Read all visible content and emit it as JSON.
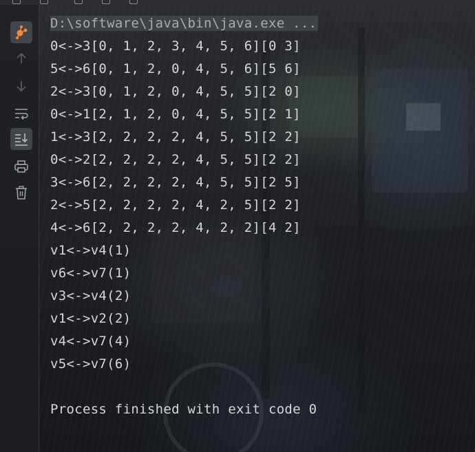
{
  "console": {
    "command": "D:\\software\\java\\bin\\java.exe ...",
    "lines": [
      "0<->3[0, 1, 2, 3, 4, 5, 6][0 3]",
      "5<->6[0, 1, 2, 0, 4, 5, 6][5 6]",
      "2<->3[0, 1, 2, 0, 4, 5, 5][2 0]",
      "0<->1[2, 1, 2, 0, 4, 5, 5][2 1]",
      "1<->3[2, 2, 2, 2, 4, 5, 5][2 2]",
      "0<->2[2, 2, 2, 2, 4, 5, 5][2 2]",
      "3<->6[2, 2, 2, 2, 4, 5, 5][2 5]",
      "2<->5[2, 2, 2, 2, 4, 2, 5][2 2]",
      "4<->6[2, 2, 2, 2, 4, 2, 2][4 2]",
      "v1<->v4(1)",
      "v6<->v7(1)",
      "v3<->v4(2)",
      "v1<->v2(2)",
      "v4<->v7(4)",
      "v5<->v7(6)"
    ],
    "exit_message": "Process finished with exit code 0"
  },
  "toolbar": {
    "icons": [
      "debug-graph-icon",
      "up-arrow-icon",
      "down-arrow-icon",
      "soft-wrap-icon",
      "scroll-to-end-icon",
      "print-icon",
      "trash-icon"
    ]
  },
  "colors": {
    "accent": "#f08a3c",
    "text": "#d5d7da",
    "icon": "#9ea2a8",
    "muted_icon": "#5d6167"
  }
}
